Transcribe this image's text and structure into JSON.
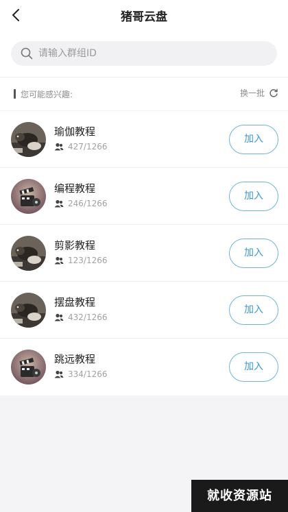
{
  "header": {
    "title": "猪哥云盘",
    "back_icon": "chevron-left-icon"
  },
  "search": {
    "placeholder": "请输入群组ID",
    "value": ""
  },
  "section": {
    "label": "您可能感兴趣:",
    "refresh_label": "换一批"
  },
  "groups": [
    {
      "name": "瑜伽教程",
      "count": "427/1266",
      "join_label": "加入",
      "avatar": "rat-photo"
    },
    {
      "name": "编程教程",
      "count": "246/1266",
      "join_label": "加入",
      "avatar": "film-clapper"
    },
    {
      "name": "剪影教程",
      "count": "123/1266",
      "join_label": "加入",
      "avatar": "rat-photo"
    },
    {
      "name": "摆盘教程",
      "count": "432/1266",
      "join_label": "加入",
      "avatar": "rat-photo"
    },
    {
      "name": "跳远教程",
      "count": "334/1266",
      "join_label": "加入",
      "avatar": "film-clapper"
    }
  ],
  "watermark": {
    "text": "就收资源站"
  },
  "colors": {
    "accent": "#3b9ad3",
    "background": "#f4f4f7"
  }
}
